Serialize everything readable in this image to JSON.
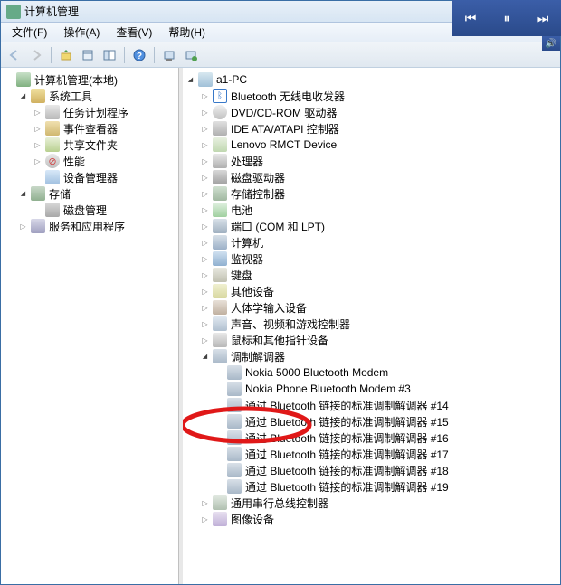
{
  "window": {
    "title": "计算机管理"
  },
  "menu": {
    "file": "文件(F)",
    "action": "操作(A)",
    "view": "查看(V)",
    "help": "帮助(H)"
  },
  "leftTree": {
    "root": "计算机管理(本地)",
    "sysTools": "系统工具",
    "sched": "任务计划程序",
    "event": "事件查看器",
    "share": "共享文件夹",
    "perf": "性能",
    "devmgr": "设备管理器",
    "storage": "存储",
    "diskmgr": "磁盘管理",
    "services": "服务和应用程序"
  },
  "rightTree": {
    "pc": "a1-PC",
    "bt": "Bluetooth 无线电收发器",
    "dvd": "DVD/CD-ROM 驱动器",
    "ide": "IDE ATA/ATAPI 控制器",
    "lenovo": "Lenovo RMCT Device",
    "cpu": "处理器",
    "disk": "磁盘驱动器",
    "storctl": "存储控制器",
    "battery": "电池",
    "port": "端口 (COM 和 LPT)",
    "computer": "计算机",
    "monitor": "监视器",
    "kbd": "键盘",
    "other": "其他设备",
    "hid": "人体学输入设备",
    "sound": "声音、视频和游戏控制器",
    "mouse": "鼠标和其他指针设备",
    "modem": "调制解调器",
    "m1": "Nokia 5000 Bluetooth Modem",
    "m2": "Nokia Phone Bluetooth Modem #3",
    "m3": "通过 Bluetooth 链接的标准调制解调器 #14",
    "m4": "通过 Bluetooth 链接的标准调制解调器 #15",
    "m5": "通过 Bluetooth 链接的标准调制解调器 #16",
    "m6": "通过 Bluetooth 链接的标准调制解调器 #17",
    "m7": "通过 Bluetooth 链接的标准调制解调器 #18",
    "m8": "通过 Bluetooth 链接的标准调制解调器 #19",
    "usb": "通用串行总线控制器",
    "img": "图像设备"
  }
}
